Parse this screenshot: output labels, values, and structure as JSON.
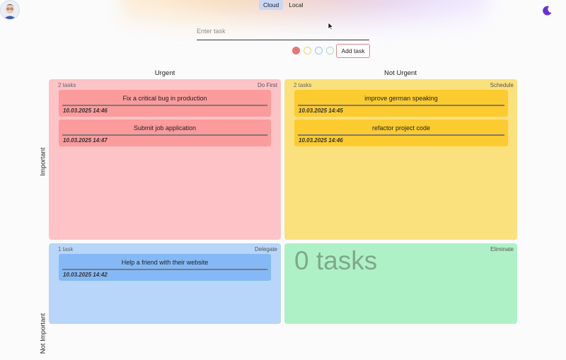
{
  "header": {
    "storage_modes": [
      {
        "label": "Cloud",
        "active": true
      },
      {
        "label": "Local",
        "active": false
      }
    ],
    "theme_icon": "moon-icon",
    "avatar_icon": "user-avatar-icon"
  },
  "task_form": {
    "placeholder": "Enter task",
    "value": "",
    "color_options": [
      {
        "name": "red",
        "color": "#e87575",
        "filled": true
      },
      {
        "name": "yellow",
        "color": "#f2d56b",
        "filled": false
      },
      {
        "name": "blue",
        "color": "#9cc3ef",
        "filled": false
      },
      {
        "name": "green",
        "color": "#9fe2c1",
        "filled": false
      }
    ],
    "add_label": "Add task"
  },
  "matrix": {
    "columns": [
      "Urgent",
      "Not Urgent"
    ],
    "rows": [
      "Important",
      "Not Important"
    ],
    "quadrants": [
      {
        "id": "do-first",
        "title": "Do First",
        "count_label": "2 tasks",
        "bg": "#fdc3c6",
        "card_bg": "#fb9b9c",
        "tasks": [
          {
            "title": "Fix a critical bug in production",
            "date": "10.03.2025 14:46"
          },
          {
            "title": "Submit job application",
            "date": "10.03.2025 14:47"
          }
        ]
      },
      {
        "id": "schedule",
        "title": "Schedule",
        "count_label": "2 tasks",
        "bg": "#fbe07e",
        "card_bg": "#fccb2f",
        "tasks": [
          {
            "title": "improve german speaking",
            "date": "10.03.2025 14:45"
          },
          {
            "title": "refactor project code",
            "date": "10.03.2025 14:46"
          }
        ]
      },
      {
        "id": "delegate",
        "title": "Delegate",
        "count_label": "1 task",
        "bg": "#b8d5fa",
        "card_bg": "#84b9f6",
        "tasks": [
          {
            "title": "Help a friend with their website",
            "date": "10.03.2025 14:42"
          }
        ]
      },
      {
        "id": "eliminate",
        "title": "Eliminate",
        "count_label": "0 tasks",
        "bg": "#aff1c6",
        "card_bg": "#7ed7a0",
        "tasks": []
      }
    ]
  }
}
